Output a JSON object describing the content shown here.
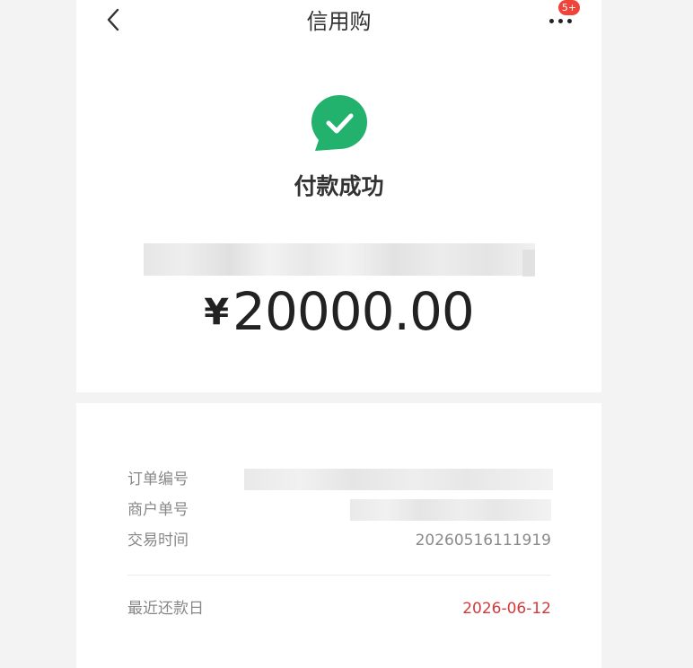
{
  "header": {
    "title": "信用购",
    "badge": "5+"
  },
  "result": {
    "status": "付款成功",
    "currency": "¥",
    "amount": "20000.00"
  },
  "details": {
    "order_no_label": "订单编号",
    "merchant_no_label": "商户单号",
    "trade_time_label": "交易时间",
    "trade_time_value": "20260516111919",
    "repay_date_label": "最近还款日",
    "repay_date_value": "2026-06-12"
  },
  "colors": {
    "success_green": "#23b26d",
    "repay_date_red": "#d23b3b",
    "badge_red": "#f0433a"
  },
  "icons": {
    "back": "chevron-left-icon",
    "more": "more-dots-icon",
    "success": "check-bubble-icon"
  }
}
